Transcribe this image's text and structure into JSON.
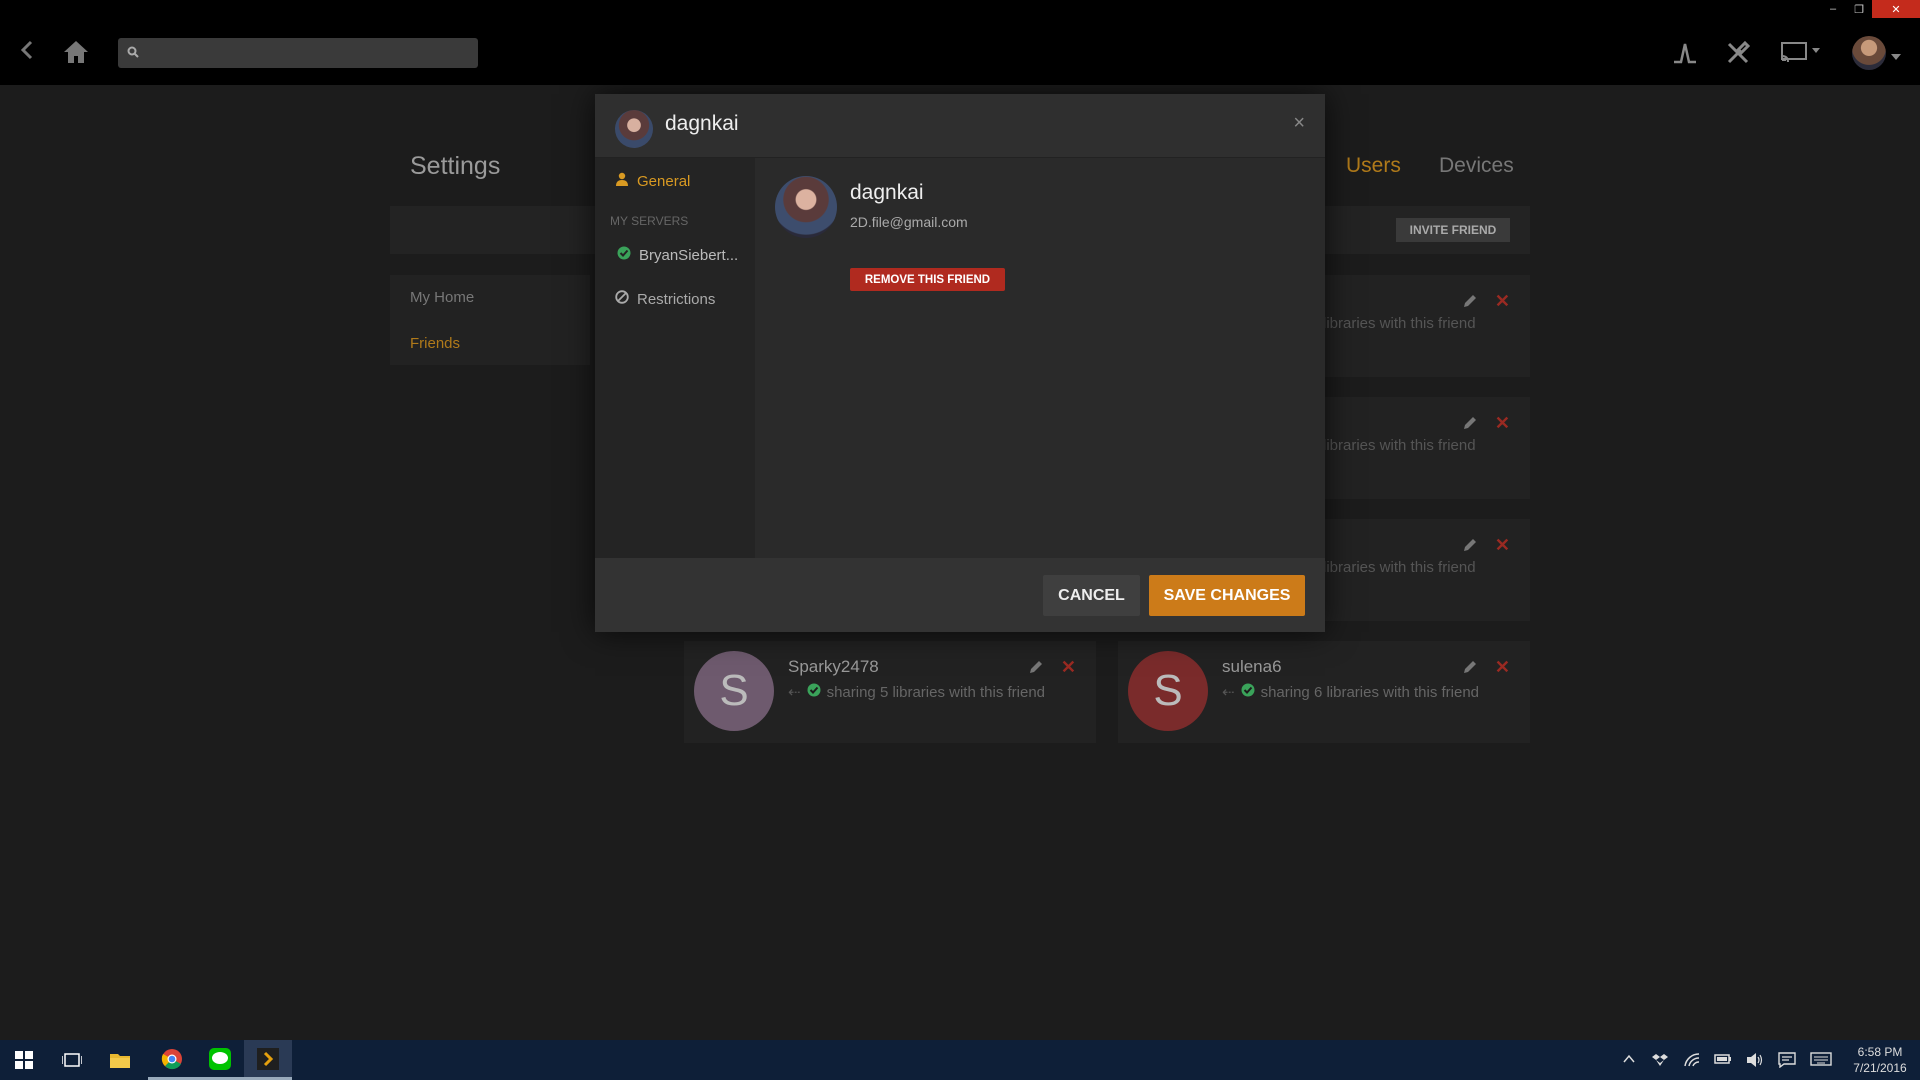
{
  "window": {
    "minimize": "–",
    "restore": "❐",
    "close": "✕"
  },
  "topbar": {
    "search_placeholder": "",
    "icons": [
      "back-icon",
      "home-icon",
      "search-icon",
      "activity-icon",
      "settings-icon",
      "cast-icon",
      "user-avatar"
    ]
  },
  "settings": {
    "title": "Settings",
    "tabs": {
      "users": "Users",
      "devices": "Devices"
    },
    "invite_label": "INVITE FRIEND",
    "nav": {
      "my_home": "My Home",
      "friends": "Friends"
    },
    "partial_share_text": "libraries with this friend",
    "friends": [
      {
        "initial": "S",
        "name": "Sparky2478",
        "share": "sharing 5 libraries with this friend",
        "color": "#6e5a6e"
      },
      {
        "initial": "S",
        "name": "sulena6",
        "share": "sharing 6 libraries with this friend",
        "color": "#7a2b2b"
      }
    ]
  },
  "modal": {
    "title": "dagnkai",
    "close": "×",
    "sidebar": {
      "general": "General",
      "heading": "MY SERVERS",
      "server": "BryanSiebert...",
      "restrictions": "Restrictions"
    },
    "user": {
      "name": "dagnkai",
      "email": "2D.file@gmail.com"
    },
    "remove_label": "REMOVE THIS FRIEND",
    "cancel_label": "CANCEL",
    "save_label": "SAVE CHANGES"
  },
  "taskbar": {
    "time": "6:58 PM",
    "date": "7/21/2016"
  },
  "colors": {
    "accent": "#cc7b19",
    "danger": "#b02a1f",
    "ok": "#3aa35a"
  }
}
